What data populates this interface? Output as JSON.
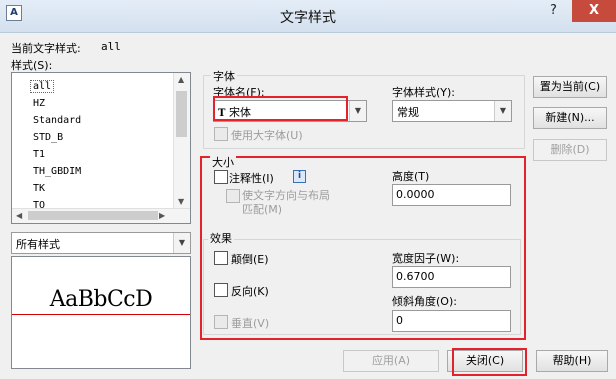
{
  "window": {
    "title": "文字样式",
    "help_glyph": "?",
    "close_glyph": "X",
    "app_icon": "A"
  },
  "current_style": {
    "label": "当前文字样式:",
    "value": "all"
  },
  "styles": {
    "label": "样式(S):",
    "items": [
      "all",
      "HZ",
      "Standard",
      "STD_B",
      "T1",
      "TH_GBDIM",
      "TK",
      "TO"
    ],
    "selected_index": 0,
    "filter_value": "所有样式"
  },
  "preview": {
    "sample": "AaBbCcD"
  },
  "font": {
    "group_label": "字体",
    "name_label": "字体名(F):",
    "name_value": "宋体",
    "name_icon_text": "T",
    "style_label": "字体样式(Y):",
    "style_value": "常规",
    "bigfont_label": "使用大字体(U)"
  },
  "size": {
    "group_label": "大小",
    "annotative_label": "注释性(I)",
    "info_glyph": "i",
    "match_label_1": "使文字方向与布局",
    "match_label_2": "匹配(M)",
    "height_label": "高度(T)",
    "height_value": "0.0000"
  },
  "effects": {
    "group_label": "效果",
    "upside_down_label": "颠倒(E)",
    "backwards_label": "反向(K)",
    "vertical_label": "垂直(V)",
    "width_factor_label": "宽度因子(W):",
    "width_factor_value": "0.6700",
    "oblique_label": "倾斜角度(O):",
    "oblique_value": "0"
  },
  "buttons": {
    "set_current": "置为当前(C)",
    "new": "新建(N)...",
    "delete": "删除(D)",
    "apply": "应用(A)",
    "close": "关闭(C)",
    "help": "帮助(H)"
  },
  "colors": {
    "highlight": "#e3222b",
    "preview_line": "#d40000"
  }
}
